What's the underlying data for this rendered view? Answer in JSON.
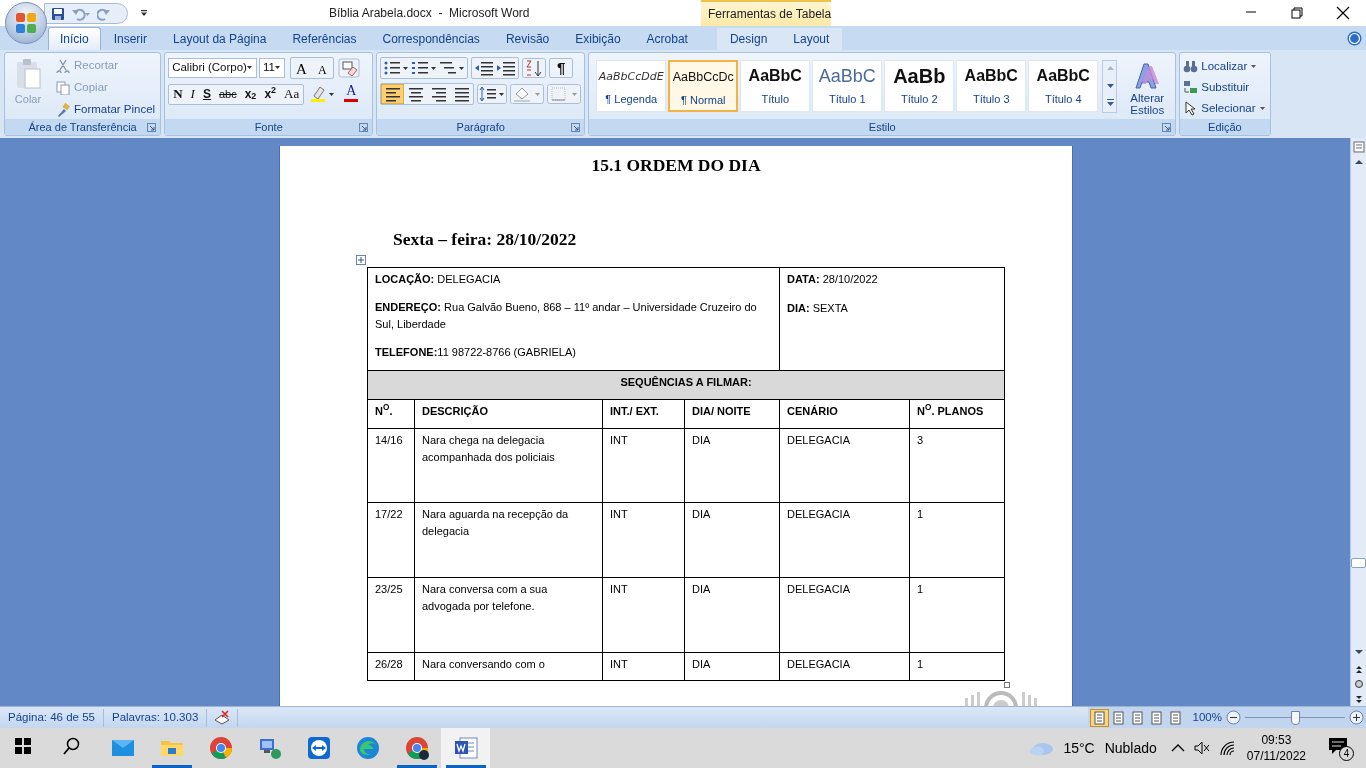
{
  "window": {
    "title": "Bíblia Arabela.docx  -  Microsoft Word",
    "contextual_group": "Ferramentas de Tabela"
  },
  "tabs": [
    {
      "label": "Início",
      "selected": true,
      "contextual": false
    },
    {
      "label": "Inserir",
      "selected": false,
      "contextual": false
    },
    {
      "label": "Layout da Página",
      "selected": false,
      "contextual": false
    },
    {
      "label": "Referências",
      "selected": false,
      "contextual": false
    },
    {
      "label": "Correspondências",
      "selected": false,
      "contextual": false
    },
    {
      "label": "Revisão",
      "selected": false,
      "contextual": false
    },
    {
      "label": "Exibição",
      "selected": false,
      "contextual": false
    },
    {
      "label": "Acrobat",
      "selected": false,
      "contextual": false
    },
    {
      "label": "Design",
      "selected": false,
      "contextual": true
    },
    {
      "label": "Layout",
      "selected": false,
      "contextual": true
    }
  ],
  "ribbon": {
    "clipboard": {
      "label": "Área de Transferência",
      "paste": {
        "label": "Colar",
        "disabled": true
      },
      "items": [
        {
          "label": "Recortar",
          "kind": "cut",
          "disabled": true
        },
        {
          "label": "Copiar",
          "kind": "copy",
          "disabled": true
        },
        {
          "label": "Formatar Pincel",
          "kind": "brush",
          "disabled": false
        }
      ]
    },
    "font": {
      "label": "Fonte",
      "font_name": "Calibri (Corpo)",
      "font_size": "11",
      "size_buttons": [
        "A",
        "A"
      ],
      "format_buttons": [
        {
          "text": "N",
          "kind": "bold"
        },
        {
          "text": "I",
          "kind": "italic"
        },
        {
          "text": "S",
          "kind": "underline"
        },
        {
          "text": "abc",
          "kind": "strike"
        },
        {
          "text": "x$_{2}$",
          "kind": "plain"
        },
        {
          "text": "x$^{2}$",
          "kind": "plain"
        },
        {
          "text": "Aa",
          "kind": "case"
        }
      ],
      "font_color": "A"
    },
    "paragraph": {
      "label": "Parágrafo",
      "pilcrow": "¶",
      "alignments": [
        {
          "kind": "left",
          "selected": true
        },
        {
          "kind": "center",
          "selected": false
        },
        {
          "kind": "right",
          "selected": false
        },
        {
          "kind": "justify",
          "selected": false
        }
      ]
    },
    "styles": {
      "label": "Estilo",
      "change_styles": "Alterar Estilos",
      "items": [
        {
          "preview": "AaBbCcDdE",
          "name": "¶ Legenda",
          "kind": "caption",
          "selected": false
        },
        {
          "preview": "AaBbCcDc",
          "name": "¶ Normal",
          "kind": "normal",
          "selected": true
        },
        {
          "preview": "AaBbC",
          "name": "Título",
          "kind": "title",
          "selected": false
        },
        {
          "preview": "AaBbC",
          "name": "Título 1",
          "kind": "heading1",
          "selected": false
        },
        {
          "preview": "AaBb",
          "name": "Título 2",
          "kind": "heading2",
          "selected": false
        },
        {
          "preview": "AaBbC",
          "name": "Título 3",
          "kind": "heading3",
          "selected": false
        },
        {
          "preview": "AaBbC",
          "name": "Título 4",
          "kind": "heading3",
          "selected": false
        }
      ]
    },
    "editing": {
      "label": "Edição",
      "items": [
        {
          "label": "Localizar",
          "kind": "find"
        },
        {
          "label": "Substituir",
          "kind": "replace"
        },
        {
          "label": "Selecionar",
          "kind": "select"
        }
      ]
    }
  },
  "document": {
    "heading": "15.1 ORDEM DO DIA",
    "subheading": "Sexta – feira: 28/10/2022",
    "info_left": [
      "**LOCAÇÃO:** DELEGACIA",
      "**ENDEREÇO:** Rua Galvão Bueno, 868 – 11º andar – Universidade Cruzeiro do Sul, Liberdade",
      "**TELEFONE:**11 98722-8766 (GABRIELA)"
    ],
    "info_right": [
      "**DATA:** 28/10/2022",
      "**DIA:** SEXTA"
    ],
    "section_title": "SEQUÊNCIAS A FILMAR:",
    "table": {
      "columns": [
        "N$^{O}$.",
        "DESCRIÇÃO",
        "INT./ EXT.",
        "DIA/ NOITE",
        "CENÁRIO",
        "N$^{O}$. PLANOS"
      ],
      "rows": [
        [
          "14/16",
          "Nara chega na delegacia acompanhada dos policiais",
          "INT",
          "DIA",
          "DELEGACIA",
          "3"
        ],
        [
          "17/22",
          "Nara aguarda na recepção da delegacia",
          "INT",
          "DIA",
          "DELEGACIA",
          "1"
        ],
        [
          "23/25",
          "Nara conversa com a sua advogada por telefone.",
          "INT",
          "DIA",
          "DELEGACIA",
          "1"
        ],
        [
          "26/28",
          "Nara conversando com o",
          "INT",
          "DIA",
          "DELEGACIA",
          "1"
        ]
      ]
    }
  },
  "status_bar": {
    "page": "Página: 46 de 55",
    "words": "Palavras: 10.303",
    "views": [
      {
        "selected": true
      },
      {
        "selected": false
      },
      {
        "selected": false
      },
      {
        "selected": false
      },
      {
        "selected": false
      }
    ],
    "zoom": "100%",
    "zoom_level": {
      "level": 0.5
    }
  },
  "taskbar": {
    "apps": [
      {
        "kind": "start",
        "running": false,
        "selected": false
      },
      {
        "kind": "search",
        "running": false,
        "selected": false
      },
      {
        "kind": "mail",
        "running": false,
        "selected": false
      },
      {
        "kind": "explorer",
        "running": true,
        "selected": false
      },
      {
        "kind": "chrome",
        "running": false,
        "selected": false
      },
      {
        "kind": "remote",
        "running": false,
        "selected": false
      },
      {
        "kind": "teamviewer",
        "running": false,
        "selected": false
      },
      {
        "kind": "edge",
        "running": false,
        "selected": false
      },
      {
        "kind": "chrome_profile",
        "running": true,
        "selected": false
      },
      {
        "kind": "word",
        "running": true,
        "selected": true
      }
    ],
    "weather": {
      "temperature": "15°C",
      "condition": "Nublado"
    },
    "time": "09:53",
    "date": "07/11/2022",
    "notifications": "4"
  }
}
